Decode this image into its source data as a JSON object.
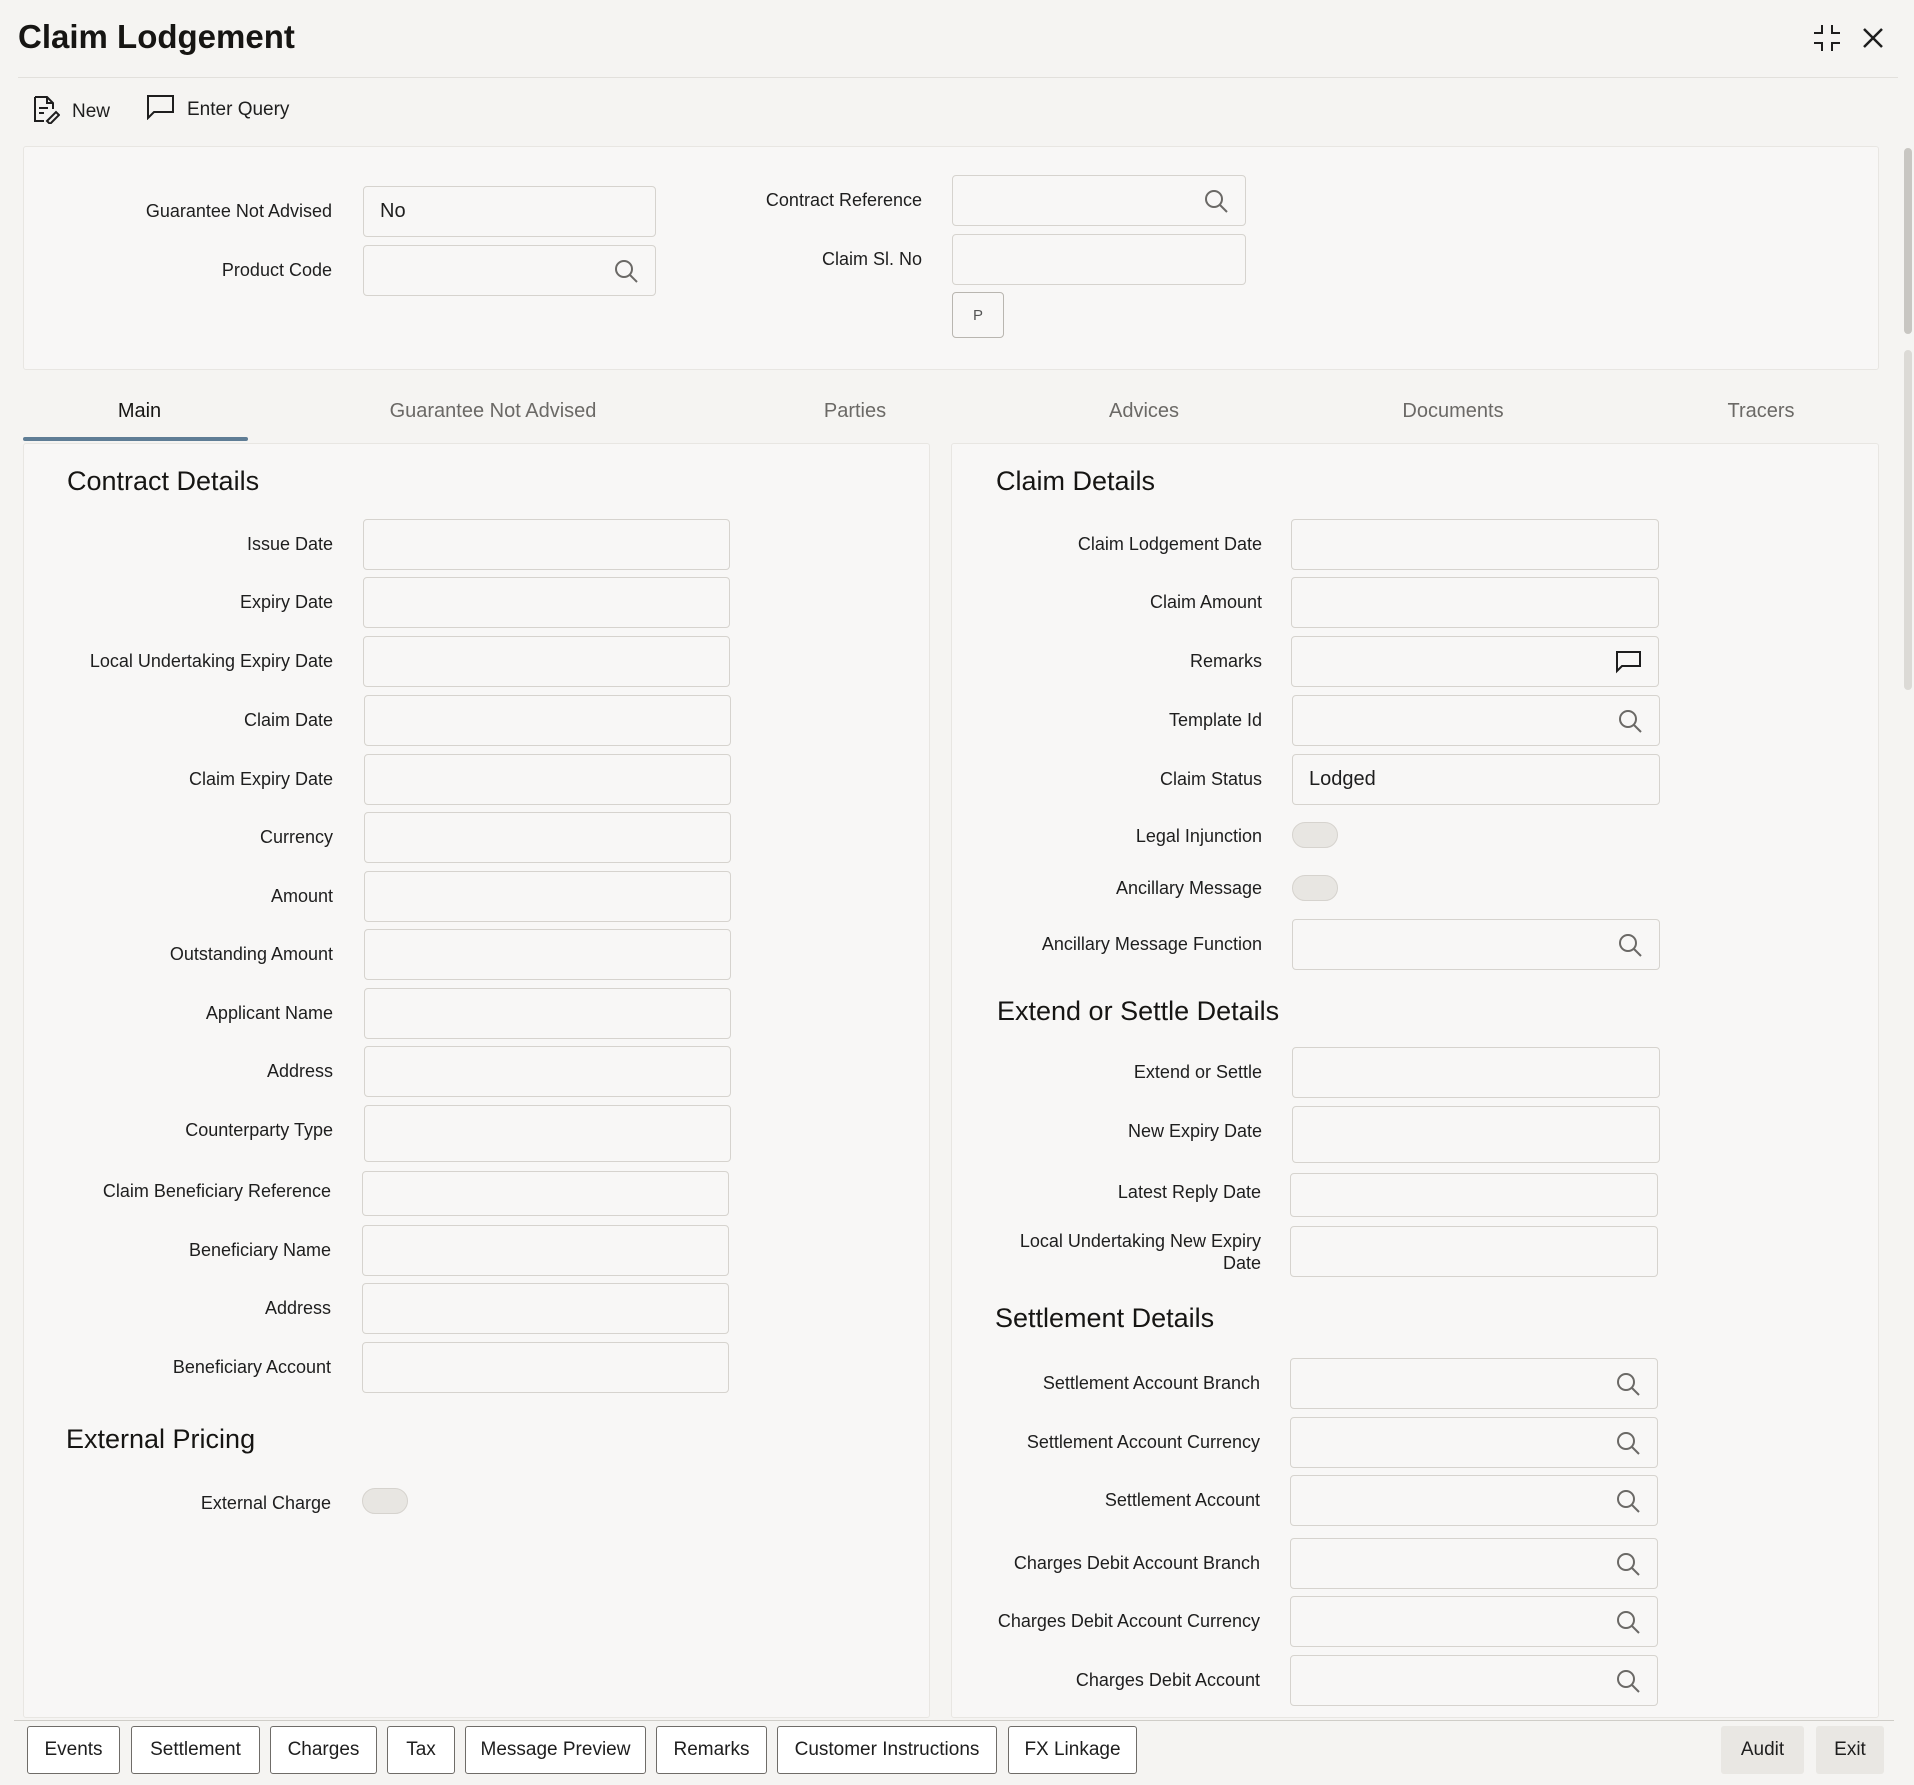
{
  "window": {
    "title": "Claim Lodgement",
    "maximize_icon": "collapse-arrows-icon",
    "close_icon": "close-icon"
  },
  "toolbar": {
    "new_label": "New",
    "enter_query_label": "Enter Query"
  },
  "header_form": {
    "guarantee_not_advised_label": "Guarantee Not Advised",
    "guarantee_not_advised_value": "No",
    "product_code_label": "Product Code",
    "product_code_value": "",
    "contract_reference_label": "Contract Reference",
    "contract_reference_value": "",
    "claim_sl_no_label": "Claim Sl. No",
    "claim_sl_no_value": "",
    "p_button_label": "P"
  },
  "tabs": [
    {
      "label": "Main",
      "active": true
    },
    {
      "label": "Guarantee Not Advised",
      "active": false
    },
    {
      "label": "Parties",
      "active": false
    },
    {
      "label": "Advices",
      "active": false
    },
    {
      "label": "Documents",
      "active": false
    },
    {
      "label": "Tracers",
      "active": false
    }
  ],
  "contract_details": {
    "heading": "Contract Details",
    "fields": [
      {
        "label": "Issue Date",
        "value": ""
      },
      {
        "label": "Expiry Date",
        "value": ""
      },
      {
        "label": "Local Undertaking Expiry Date",
        "value": ""
      },
      {
        "label": "Claim Date",
        "value": ""
      },
      {
        "label": "Claim Expiry Date",
        "value": ""
      },
      {
        "label": "Currency",
        "value": ""
      },
      {
        "label": "Amount",
        "value": ""
      },
      {
        "label": "Outstanding Amount",
        "value": ""
      },
      {
        "label": "Applicant Name",
        "value": ""
      },
      {
        "label": "Address",
        "value": ""
      },
      {
        "label": "Counterparty Type",
        "value": ""
      },
      {
        "label": "Claim Beneficiary Reference",
        "value": ""
      },
      {
        "label": "Beneficiary Name",
        "value": ""
      },
      {
        "label": "Address",
        "value": ""
      },
      {
        "label": "Beneficiary Account",
        "value": ""
      }
    ]
  },
  "external_pricing": {
    "heading": "External Pricing",
    "external_charge_label": "External Charge",
    "external_charge_on": false
  },
  "claim_details": {
    "heading": "Claim Details",
    "claim_lodgement_date_label": "Claim Lodgement Date",
    "claim_amount_label": "Claim Amount",
    "remarks_label": "Remarks",
    "template_id_label": "Template Id",
    "claim_status_label": "Claim Status",
    "claim_status_value": "Lodged",
    "legal_injunction_label": "Legal Injunction",
    "legal_injunction_on": false,
    "ancillary_message_label": "Ancillary Message",
    "ancillary_message_on": false,
    "ancillary_message_function_label": "Ancillary Message Function"
  },
  "extend_settle": {
    "heading": "Extend or Settle Details",
    "extend_or_settle_label": "Extend or Settle",
    "new_expiry_date_label": "New Expiry Date",
    "latest_reply_date_label": "Latest Reply Date",
    "local_new_expiry_label_line1": "Local Undertaking New Expiry",
    "local_new_expiry_label_line2": "Date"
  },
  "settlement": {
    "heading": "Settlement Details",
    "fields": [
      {
        "label": "Settlement Account Branch"
      },
      {
        "label": "Settlement Account Currency"
      },
      {
        "label": "Settlement Account"
      },
      {
        "label": "Charges Debit Account Branch"
      },
      {
        "label": "Charges Debit Account Currency"
      },
      {
        "label": "Charges Debit Account"
      }
    ]
  },
  "footer": {
    "buttons": [
      "Events",
      "Settlement",
      "Charges",
      "Tax",
      "Message Preview",
      "Remarks",
      "Customer Instructions",
      "FX Linkage"
    ],
    "audit_label": "Audit",
    "exit_label": "Exit"
  }
}
